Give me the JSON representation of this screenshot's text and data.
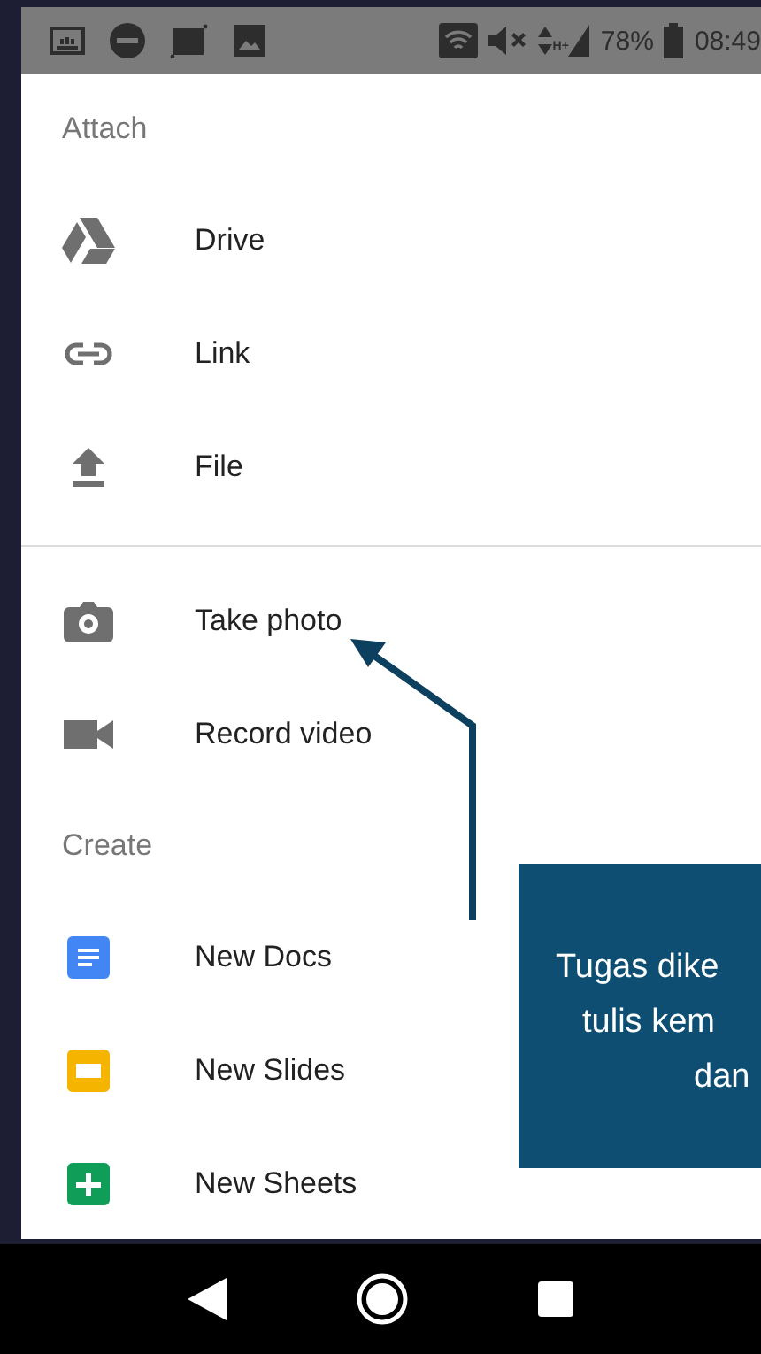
{
  "status_bar": {
    "network_type": "H+",
    "battery": "78%",
    "time": "08:49"
  },
  "groups": [
    {
      "header": "Attach",
      "divider_before": false,
      "items": [
        {
          "label": "Drive",
          "kind": "drive"
        },
        {
          "label": "Link",
          "kind": "link"
        },
        {
          "label": "File",
          "kind": "upload"
        }
      ]
    },
    {
      "divider_before": true,
      "items": [
        {
          "label": "Take photo",
          "kind": "camera"
        },
        {
          "label": "Record video",
          "kind": "video"
        }
      ]
    },
    {
      "header": "Create",
      "divider_before": false,
      "items": [
        {
          "label": "New Docs",
          "kind": "docs",
          "color": "#4285f4"
        },
        {
          "label": "New Slides",
          "kind": "slides",
          "color": "#f4b400"
        },
        {
          "label": "New Sheets",
          "kind": "sheets",
          "color": "#0f9d58"
        }
      ]
    }
  ],
  "callout": {
    "lines": [
      "Tugas dike",
      "tulis kem",
      "dan"
    ]
  }
}
